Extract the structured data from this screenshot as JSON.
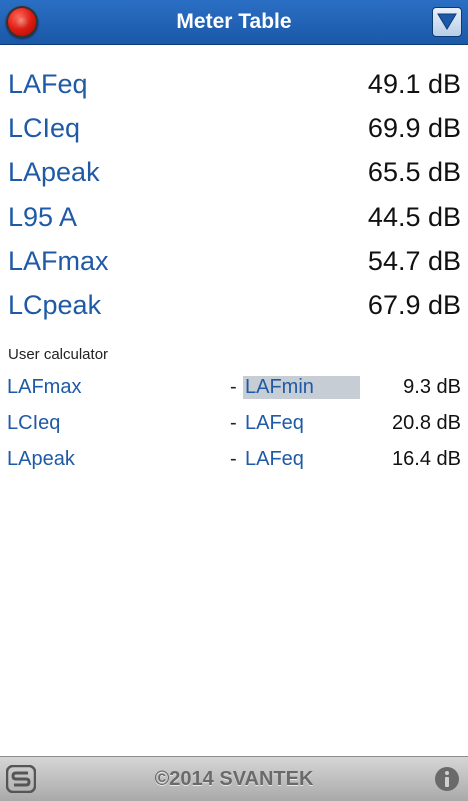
{
  "header": {
    "title": "Meter Table"
  },
  "readings": [
    {
      "label": "LAFeq",
      "value": "49.1 dB"
    },
    {
      "label": "LCIeq",
      "value": "69.9 dB"
    },
    {
      "label": "LApeak",
      "value": "65.5 dB"
    },
    {
      "label": "L95 A",
      "value": "44.5 dB"
    },
    {
      "label": "LAFmax",
      "value": "54.7 dB"
    },
    {
      "label": "LCpeak",
      "value": "67.9 dB"
    }
  ],
  "calculator": {
    "title": "User calculator",
    "rows": [
      {
        "a": "LAFmax",
        "op": "-",
        "b": "LAFmin",
        "result": "9.3 dB"
      },
      {
        "a": "LCIeq",
        "op": "-",
        "b": "LAFeq",
        "result": "20.8 dB"
      },
      {
        "a": "LApeak",
        "op": "-",
        "b": "LAFeq",
        "result": "16.4 dB"
      }
    ]
  },
  "footer": {
    "copyright": "©2014 SVANTEK"
  },
  "icons": [
    "record-icon",
    "menu-dropdown-icon",
    "svantek-logo-icon",
    "info-icon"
  ],
  "colors": {
    "header": "#1b58a8",
    "label": "#1f5aa6",
    "footer": "#a9a9a9",
    "selected": "#c6cdd4"
  }
}
